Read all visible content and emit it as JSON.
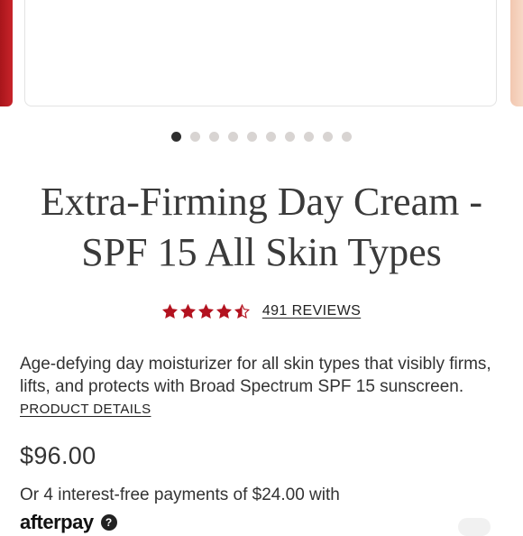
{
  "carousel": {
    "slide_count": 10,
    "active_index": 0
  },
  "product": {
    "title": "Extra-Firming Day Cream - SPF 15 All Skin Types",
    "rating": 4.5,
    "rating_max": 5,
    "reviews_label": "491 REVIEWS",
    "description": "Age-defying day moisturizer for all skin types that visibly firms, lifts, and protects with Broad Spectrum SPF 15 sunscreen.",
    "details_link": "PRODUCT DETAILS",
    "price": "$96.00",
    "installments_text": "Or 4 interest-free payments of $24.00 with",
    "afterpay_logo": "afterpay",
    "help_icon": "?"
  },
  "colors": {
    "star": "#b3121f",
    "active_dot": "#2f2f2f",
    "inactive_dot": "#d8d4d2"
  }
}
